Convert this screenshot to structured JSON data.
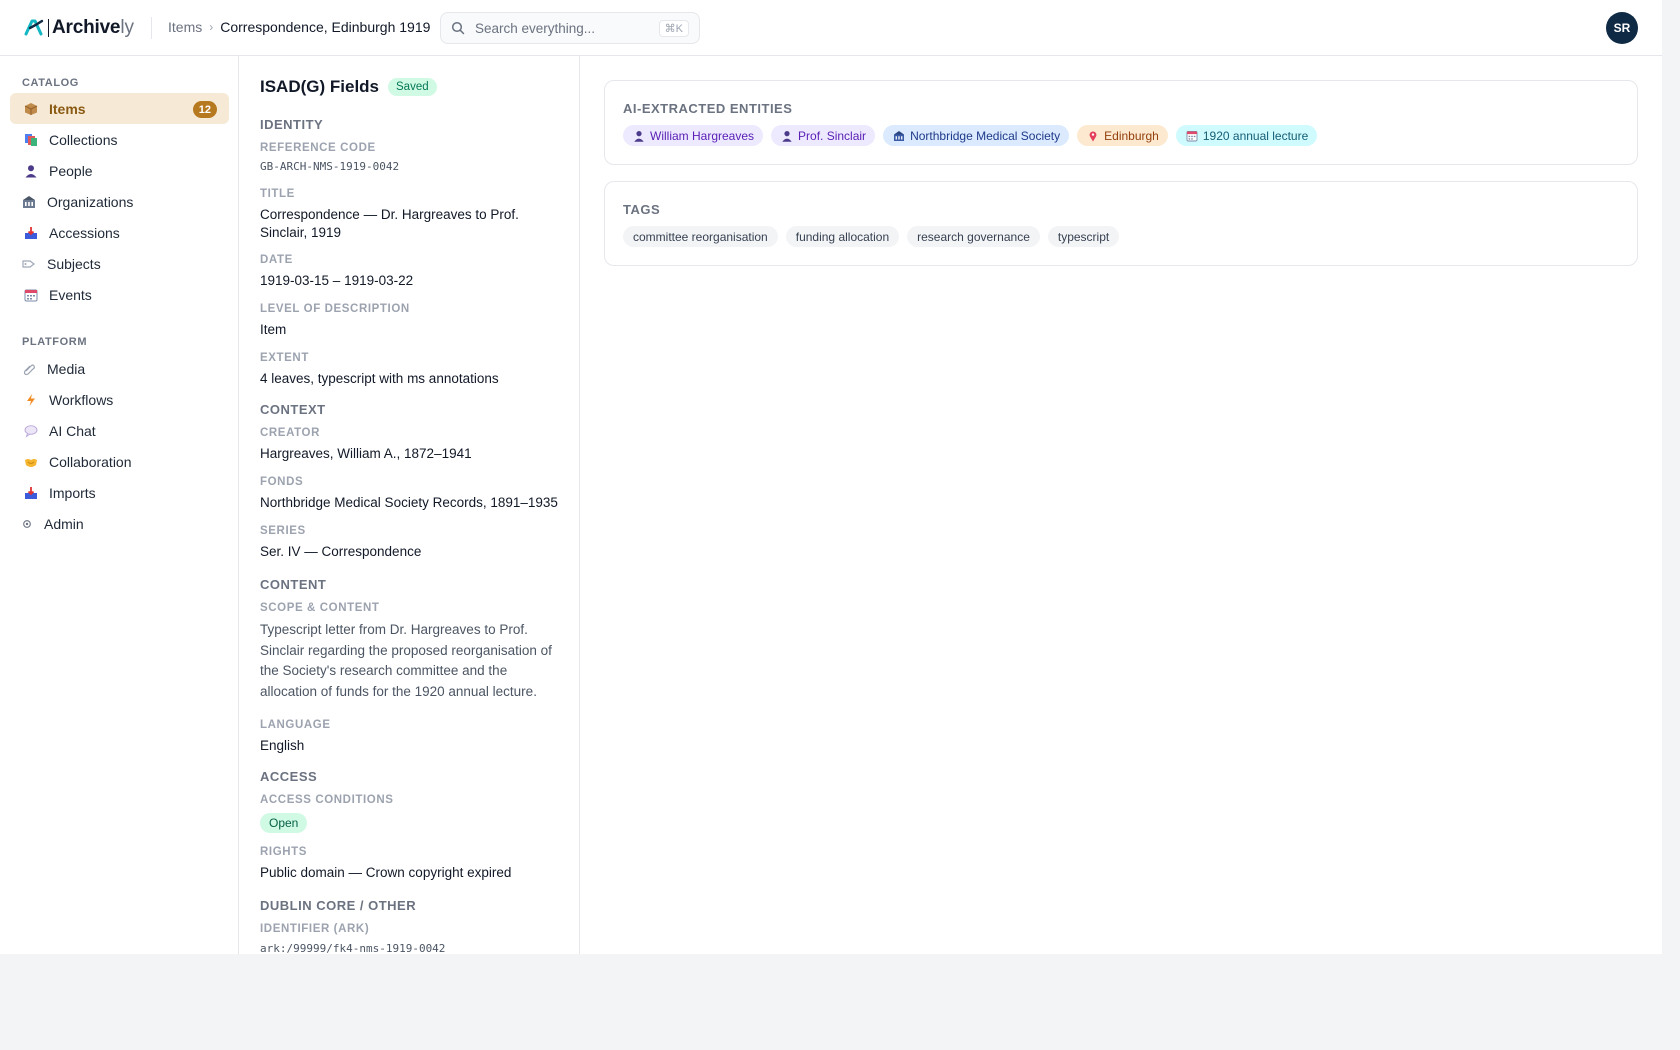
{
  "app": {
    "logo_main": "Archive",
    "logo_suffix": "ly"
  },
  "header": {
    "breadcrumb": {
      "parent": "Items",
      "separator": "›",
      "current": "Correspondence, Edinburgh 1919"
    },
    "search": {
      "placeholder": "Search everything...",
      "shortcut": "⌘K"
    },
    "user_initials": "SR"
  },
  "sidebar": {
    "catalog_label": "CATALOG",
    "catalog_items": [
      {
        "label": "Items",
        "icon": "box-icon",
        "badge": "12",
        "active": true
      },
      {
        "label": "Collections",
        "icon": "collections-icon"
      },
      {
        "label": "People",
        "icon": "person-icon"
      },
      {
        "label": "Organizations",
        "icon": "building-icon"
      },
      {
        "label": "Accessions",
        "icon": "inbox-icon"
      },
      {
        "label": "Subjects",
        "icon": "tag-icon"
      },
      {
        "label": "Events",
        "icon": "calendar-icon"
      }
    ],
    "platform_label": "PLATFORM",
    "platform_items": [
      {
        "label": "Media",
        "icon": "paperclip-icon"
      },
      {
        "label": "Workflows",
        "icon": "lightning-icon"
      },
      {
        "label": "AI Chat",
        "icon": "chat-bubble-icon"
      },
      {
        "label": "Collaboration",
        "icon": "handshake-icon"
      },
      {
        "label": "Imports",
        "icon": "import-tray-icon"
      },
      {
        "label": "Admin",
        "icon": "gear-icon"
      }
    ]
  },
  "fields": {
    "title": "ISAD(G) Fields",
    "saved_badge": "Saved",
    "identity": {
      "heading": "IDENTITY",
      "reference_code_label": "REFERENCE CODE",
      "reference_code": "GB-ARCH-NMS-1919-0042",
      "title_label": "TITLE",
      "title_value": "Correspondence — Dr. Hargreaves to Prof. Sinclair, 1919",
      "date_label": "DATE",
      "date_value": "1919-03-15 – 1919-03-22",
      "level_label": "LEVEL OF DESCRIPTION",
      "level_value": "Item",
      "extent_label": "EXTENT",
      "extent_value": "4 leaves, typescript with ms annotations"
    },
    "context": {
      "heading": "CONTEXT",
      "creator_label": "CREATOR",
      "creator_value": "Hargreaves, William A., 1872–1941",
      "fonds_label": "FONDS",
      "fonds_value": "Northbridge Medical Society Records, 1891–1935",
      "series_label": "SERIES",
      "series_value": "Ser. IV — Correspondence"
    },
    "content": {
      "heading": "CONTENT",
      "scope_label": "SCOPE & CONTENT",
      "scope_value": "Typescript letter from Dr. Hargreaves to Prof. Sinclair regarding the proposed reorganisation of the Society's research committee and the allocation of funds for the 1920 annual lecture.",
      "language_label": "LANGUAGE",
      "language_value": "English"
    },
    "access": {
      "heading": "ACCESS",
      "conditions_label": "ACCESS CONDITIONS",
      "conditions_value": "Open",
      "rights_label": "RIGHTS",
      "rights_value": "Public domain — Crown copyright expired"
    },
    "dublin_core": {
      "heading": "DUBLIN CORE / OTHER",
      "identifier_label": "IDENTIFIER (ARK)",
      "identifier_value": "ark:/99999/fk4-nms-1919-0042"
    }
  },
  "entities": {
    "title": "AI-EXTRACTED ENTITIES",
    "items": [
      {
        "label": "William Hargreaves",
        "type": "person",
        "icon": "person-icon"
      },
      {
        "label": "Prof. Sinclair",
        "type": "person",
        "icon": "person-icon"
      },
      {
        "label": "Northbridge Medical Society",
        "type": "org",
        "icon": "building-icon"
      },
      {
        "label": "Edinburgh",
        "type": "place",
        "icon": "map-pin-icon"
      },
      {
        "label": "1920 annual lecture",
        "type": "event",
        "icon": "calendar-icon"
      }
    ]
  },
  "tags": {
    "title": "TAGS",
    "items": [
      "committee reorganisation",
      "funding allocation",
      "research governance",
      "typescript"
    ]
  },
  "colors": {
    "accent": "#b7791f",
    "active_bg": "#f6ead6",
    "avatar_bg": "#0f2a44",
    "saved_bg": "#d1fae5",
    "logo_teal": "#14b8c4"
  }
}
